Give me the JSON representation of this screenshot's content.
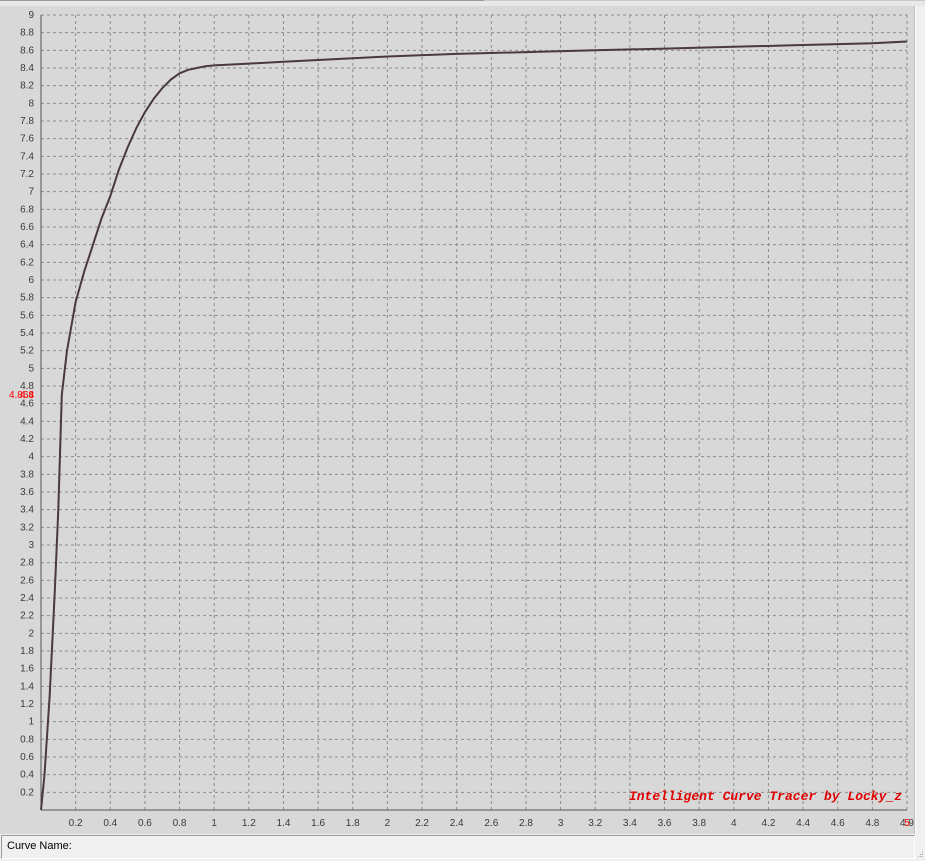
{
  "status": {
    "curve_name_label": "Curve Name:",
    "curve_name_value": ""
  },
  "chart_data": {
    "type": "line",
    "watermark": "Intelligent Curve Tracer by Locky_z",
    "cursor_readout": {
      "y_value": "4.864",
      "y_label_overlap": "4.8",
      "x_value": "5",
      "x_edge_label": "4.9"
    },
    "xlim": [
      0,
      5.0
    ],
    "ylim": [
      0,
      9
    ],
    "x_ticks": [
      0.2,
      0.4,
      0.6,
      0.8,
      1,
      1.2,
      1.4,
      1.6,
      1.8,
      2,
      2.2,
      2.4,
      2.6,
      2.8,
      3,
      3.2,
      3.4,
      3.6,
      3.8,
      4,
      4.2,
      4.4,
      4.6,
      4.8
    ],
    "y_ticks": [
      0.2,
      0.4,
      0.6,
      0.8,
      1,
      1.2,
      1.4,
      1.6,
      1.8,
      2,
      2.2,
      2.4,
      2.6,
      2.8,
      3,
      3.2,
      3.4,
      3.6,
      3.8,
      4,
      4.2,
      4.4,
      4.6,
      4.8,
      5,
      5.2,
      5.4,
      5.6,
      5.8,
      6,
      6.2,
      6.4,
      6.6,
      6.8,
      7,
      7.2,
      7.4,
      7.6,
      7.8,
      8,
      8.2,
      8.4,
      8.6,
      8.8,
      9
    ],
    "grid": true,
    "colors": {
      "background": "#d8d8d8",
      "grid": "#8c8c8c",
      "curve": "#4a3a3a",
      "tick_text": "#3a3a3a",
      "readout": "#ff0000"
    },
    "series": [
      {
        "x": [
          0.0,
          0.02,
          0.05,
          0.08,
          0.1,
          0.12,
          0.15,
          0.2,
          0.25,
          0.3,
          0.35,
          0.4,
          0.45,
          0.5,
          0.55,
          0.6,
          0.65,
          0.7,
          0.75,
          0.8,
          0.85,
          0.9,
          0.95,
          1.0,
          1.1,
          1.2,
          1.4,
          1.6,
          1.8,
          2.0,
          2.4,
          2.8,
          3.2,
          3.6,
          4.0,
          4.4,
          4.8,
          5.0
        ],
        "y": [
          0.0,
          0.4,
          1.3,
          2.5,
          3.4,
          4.7,
          5.2,
          5.75,
          6.1,
          6.4,
          6.7,
          6.95,
          7.25,
          7.5,
          7.72,
          7.9,
          8.05,
          8.17,
          8.27,
          8.34,
          8.38,
          8.4,
          8.42,
          8.43,
          8.44,
          8.45,
          8.47,
          8.49,
          8.51,
          8.53,
          8.56,
          8.58,
          8.6,
          8.62,
          8.64,
          8.66,
          8.68,
          8.7
        ]
      }
    ]
  }
}
